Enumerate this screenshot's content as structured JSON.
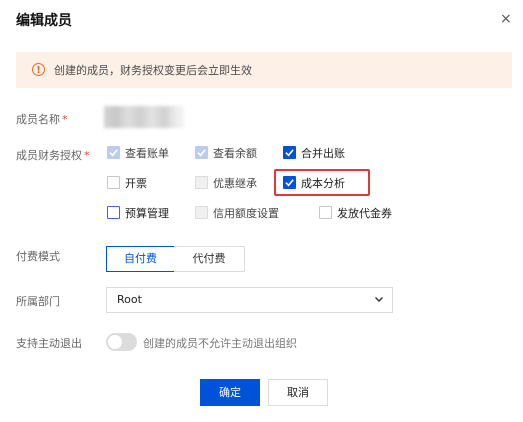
{
  "dialog": {
    "title": "编辑成员",
    "close_glyph": "×"
  },
  "notice": {
    "icon": "warning-circle-icon",
    "icon_glyph": "!",
    "text": "创建的成员，财务授权变更后会立即生效",
    "color": "#e06c2b"
  },
  "form": {
    "required_mark": "*",
    "member_name": {
      "label": "成员名称",
      "value_hidden": true
    },
    "finance_auth": {
      "label": "成员财务授权",
      "options": [
        {
          "label": "查看账单",
          "checked": true,
          "disabled": true
        },
        {
          "label": "查看余额",
          "checked": true,
          "disabled": true
        },
        {
          "label": "合并出账",
          "checked": true,
          "disabled": false
        },
        {
          "label": "开票",
          "checked": false,
          "disabled": false
        },
        {
          "label": "优惠继承",
          "checked": false,
          "disabled": true
        },
        {
          "label": "成本分析",
          "checked": true,
          "disabled": false,
          "highlighted": true
        },
        {
          "label": "预算管理",
          "checked": false,
          "disabled": false
        },
        {
          "label": "信用额度设置",
          "checked": false,
          "disabled": true
        },
        {
          "label": "发放代金券",
          "checked": false,
          "disabled": false
        }
      ]
    },
    "payment_mode": {
      "label": "付费模式",
      "options": [
        "自付费",
        "代付费"
      ],
      "selected": "自付费"
    },
    "department": {
      "label": "所属部门",
      "value": "Root"
    },
    "allow_exit": {
      "label": "支持主动退出",
      "enabled": false,
      "description": "创建的成员不允许主动退出组织"
    }
  },
  "buttons": {
    "confirm": "确定",
    "cancel": "取消"
  },
  "colors": {
    "primary": "#0052d9",
    "highlight_border": "#d93b3b",
    "notice_bg": "#fdf0e6"
  }
}
